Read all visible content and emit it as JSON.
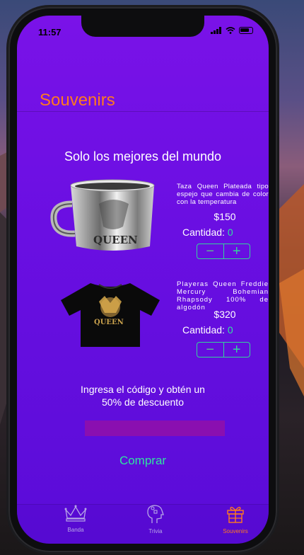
{
  "status": {
    "time": "11:57"
  },
  "nav": {
    "title": "Souvenirs"
  },
  "section": {
    "title": "Solo los mejores del mundo"
  },
  "products": [
    {
      "image": "queen-silver-mug",
      "description": "Taza Queen Plateada tipo espejo que cambia de color con la temperatura",
      "price": "$150",
      "quantity_label": "Cantidad:",
      "quantity": "0",
      "minus": "−",
      "plus": "+"
    },
    {
      "image": "queen-black-tshirt",
      "description": "Playeras Queen Freddie Mercury Bohemian Rhapsody 100% de algodón",
      "price": "$320",
      "quantity_label": "Cantidad:",
      "quantity": "0",
      "minus": "−",
      "plus": "+"
    }
  ],
  "promo": {
    "line1": "Ingresa el código y obtén un",
    "line2": "50% de descuento",
    "input_value": ""
  },
  "buy": {
    "label": "Comprar"
  },
  "tabs": [
    {
      "label": "Banda",
      "icon": "crown-icon",
      "active": false
    },
    {
      "label": "Trivia",
      "icon": "head-puzzle-icon",
      "active": false
    },
    {
      "label": "Souvenirs",
      "icon": "gift-icon",
      "active": true
    }
  ],
  "colors": {
    "accent": "#ff7a1f",
    "green": "#31e3a0",
    "background": "#6a0fe2",
    "input": "#8a0fb0"
  }
}
